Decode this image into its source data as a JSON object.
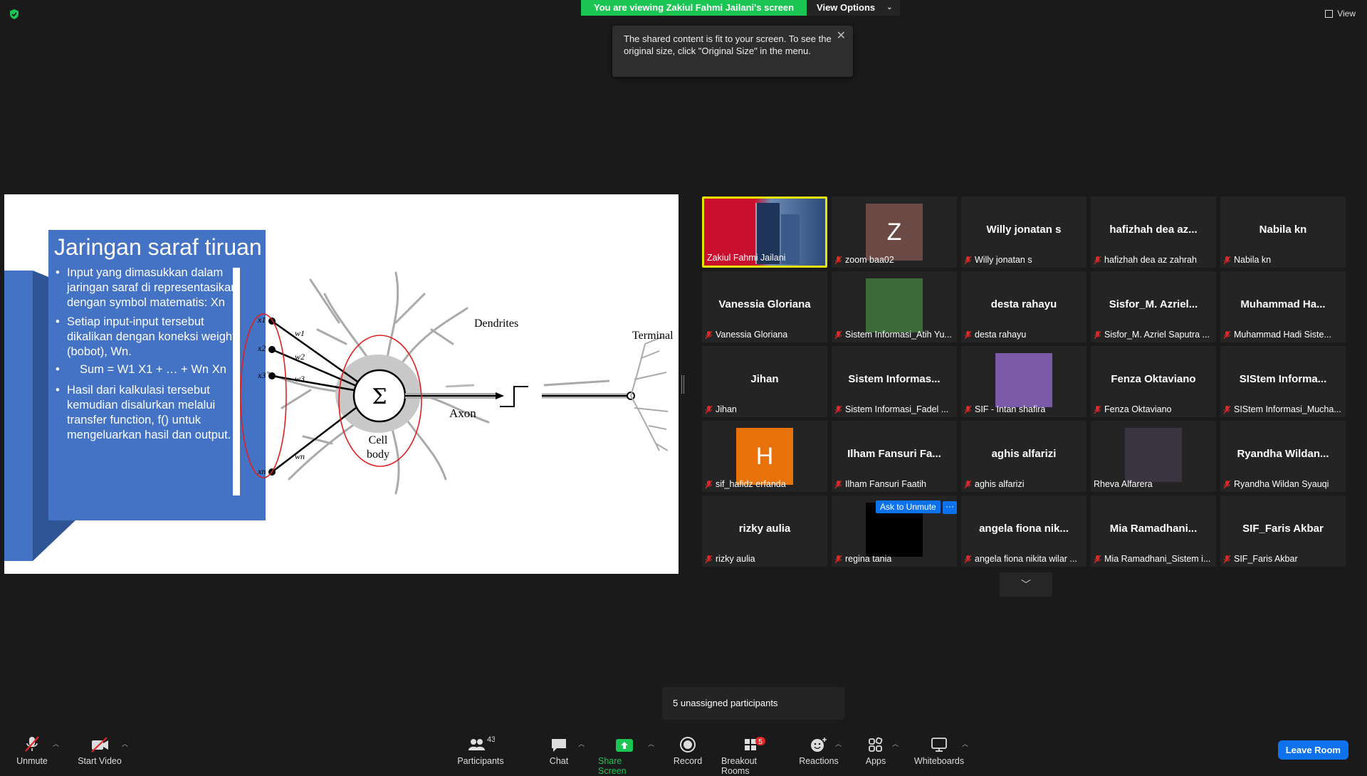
{
  "top": {
    "viewing_label": "You are viewing Zakiul Fahmi Jailani's screen",
    "view_options": "View Options",
    "view_right": "View"
  },
  "tooltip": {
    "text": "The shared content is fit to your screen. To see the original size, click \"Original Size\" in the menu."
  },
  "slide": {
    "title": "Jaringan saraf tiruan",
    "bullet1": "Input yang dimasukkan dalam jaringan saraf di representasikan dengan symbol matematis: Xn",
    "bullet2": "Setiap input-input tersebut dikalikan dengan koneksi weight (bobot), Wn.",
    "sum": "Sum = W1 X1 + … + Wn Xn",
    "bullet3": "Hasil dari kalkulasi tersebut kemudian disalurkan melalui transfer function, f() untuk mengeluarkan hasil dan output.",
    "diagram": {
      "dendrites": "Dendrites",
      "terminals": "Terminals",
      "axon": "Axon",
      "cell_body_1": "Cell",
      "cell_body_2": "body",
      "sigma": "Σ",
      "x1": "x1",
      "x2": "x2",
      "x3": "x3",
      "xn": "xn",
      "w1": "w1",
      "w2": "w2",
      "w3": "w3",
      "wn": "wn"
    }
  },
  "participants": [
    {
      "big": "",
      "name": "Zakiul Fahmi Jailani",
      "muted": false,
      "type": "video",
      "active": true
    },
    {
      "big": "",
      "name": "zoom baa02",
      "muted": true,
      "type": "avatar",
      "letter": "Z",
      "color": "#6b4a45"
    },
    {
      "big": "Willy jonatan s",
      "name": "Willy jonatan s",
      "muted": true
    },
    {
      "big": "hafizhah dea az...",
      "name": "hafizhah dea az zahrah",
      "muted": true
    },
    {
      "big": "Nabila kn",
      "name": "Nabila kn",
      "muted": true
    },
    {
      "big": "Vanessia Gloriana",
      "name": "Vanessia Gloriana",
      "muted": true
    },
    {
      "big": "",
      "name": "Sistem Informasi_Atih Yu...",
      "muted": true,
      "type": "photo",
      "color": "#3d6b3a"
    },
    {
      "big": "desta rahayu",
      "name": "desta rahayu",
      "muted": true
    },
    {
      "big": "Sisfor_M. Azriel...",
      "name": "Sisfor_M. Azriel Saputra ...",
      "muted": true
    },
    {
      "big": "Muhammad  Ha...",
      "name": "Muhammad Hadi Siste...",
      "muted": true
    },
    {
      "big": "Jihan",
      "name": "Jihan",
      "muted": true
    },
    {
      "big": "Sistem  Informas...",
      "name": "Sistem Informasi_Fadel ...",
      "muted": true
    },
    {
      "big": "",
      "name": "SIF - Intan shafira",
      "muted": true,
      "type": "photo",
      "color": "#7a5aa8"
    },
    {
      "big": "Fenza Oktaviano",
      "name": "Fenza Oktaviano",
      "muted": true
    },
    {
      "big": "SIStem  Informa...",
      "name": "SIStem Informasi_Mucha...",
      "muted": true
    },
    {
      "big": "",
      "name": "sif_hafidz erfanda",
      "muted": true,
      "type": "avatar",
      "letter": "H",
      "color": "#e8710a"
    },
    {
      "big": "Ilham Fansuri Fa...",
      "name": "Ilham Fansuri Faatih",
      "muted": true
    },
    {
      "big": "aghis alfarizi",
      "name": "aghis alfarizi",
      "muted": true
    },
    {
      "big": "",
      "name": "Rheva Alfarera",
      "muted": false,
      "type": "photo",
      "color": "#3a3340"
    },
    {
      "big": "Ryandha  Wildan...",
      "name": "Ryandha Wildan Syauqi",
      "muted": true
    },
    {
      "big": "rizky aulia",
      "name": "rizky aulia",
      "muted": true
    },
    {
      "big": "",
      "name": "regina tania",
      "muted": true,
      "type": "photo",
      "color": "#000000"
    },
    {
      "big": "angela fiona nik...",
      "name": "angela fiona nikita wilar ...",
      "muted": true
    },
    {
      "big": "Mia  Ramadhani...",
      "name": "Mia Ramadhani_Sistem i...",
      "muted": true
    },
    {
      "big": "SIF_Faris Akbar",
      "name": "SIF_Faris Akbar",
      "muted": true
    }
  ],
  "ask_to_unmute": "Ask to Unmute",
  "more": "···",
  "unassigned": "5 unassigned participants",
  "toolbar": {
    "unmute": "Unmute",
    "start_video": "Start Video",
    "participants": "Participants",
    "participants_count": "43",
    "chat": "Chat",
    "share_screen": "Share Screen",
    "record": "Record",
    "breakout_rooms": "Breakout Rooms",
    "breakout_badge": "5",
    "reactions": "Reactions",
    "apps": "Apps",
    "whiteboards": "Whiteboards",
    "leave_room": "Leave Room"
  },
  "colors": {
    "zoom_green": "#1bc553",
    "zoom_blue": "#0e72ed",
    "slide_blue": "#4472c4",
    "mute_red": "#e02828"
  }
}
